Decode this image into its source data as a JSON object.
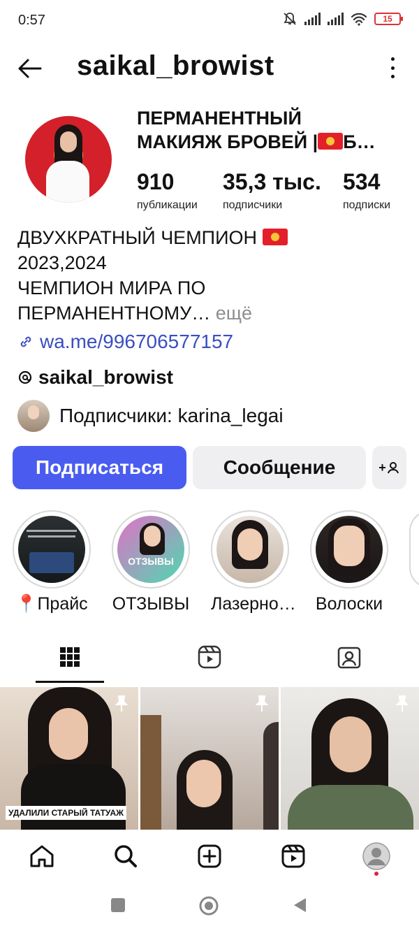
{
  "status_bar": {
    "time": "0:57",
    "battery": "15"
  },
  "header": {
    "username": "saikal_browist"
  },
  "profile": {
    "name": "ПЕРМАНЕНТНЫЙ МАКИЯЖ БРОВЕЙ |🇰🇬Б…",
    "name_line1": "ПЕРМАНЕНТНЫЙ",
    "name_line2": "МАКИЯЖ БРОВЕЙ |",
    "name_line2_tail": "Б…",
    "stats": [
      {
        "num": "910",
        "label": "публикации"
      },
      {
        "num": "35,3 тыс.",
        "label": "подписчики"
      },
      {
        "num": "534",
        "label": "подписки"
      }
    ],
    "bio_line1": "ДВУХКРАТНЫЙ ЧЕМПИОН",
    "bio_line2": "2023,2024",
    "bio_line3": "ЧЕМПИОН МИРА ПО",
    "bio_line4": "ПЕРМАНЕНТНОМУ…",
    "bio_more": "ещё",
    "link": "wa.me/996706577157",
    "threads": "saikal_browist",
    "followers_prefix": "Подписчики:",
    "followers_name": "karina_legai"
  },
  "actions": {
    "follow": "Подписаться",
    "message": "Сообщение",
    "add_person": "+"
  },
  "highlights": [
    {
      "label": "📍Прайс"
    },
    {
      "label": "ОТЗЫВЫ",
      "inner_text": "ОТЗЫВЫ"
    },
    {
      "label": "Лазерно…"
    },
    {
      "label": "Волоски"
    }
  ],
  "grid": [
    {
      "caption": "УДАЛИЛИ СТАРЫЙ ТАТУАЖ"
    },
    {},
    {}
  ],
  "colors": {
    "accent": "#4a5cf0",
    "link": "#3a4ec1",
    "notification": "#e5213c"
  }
}
